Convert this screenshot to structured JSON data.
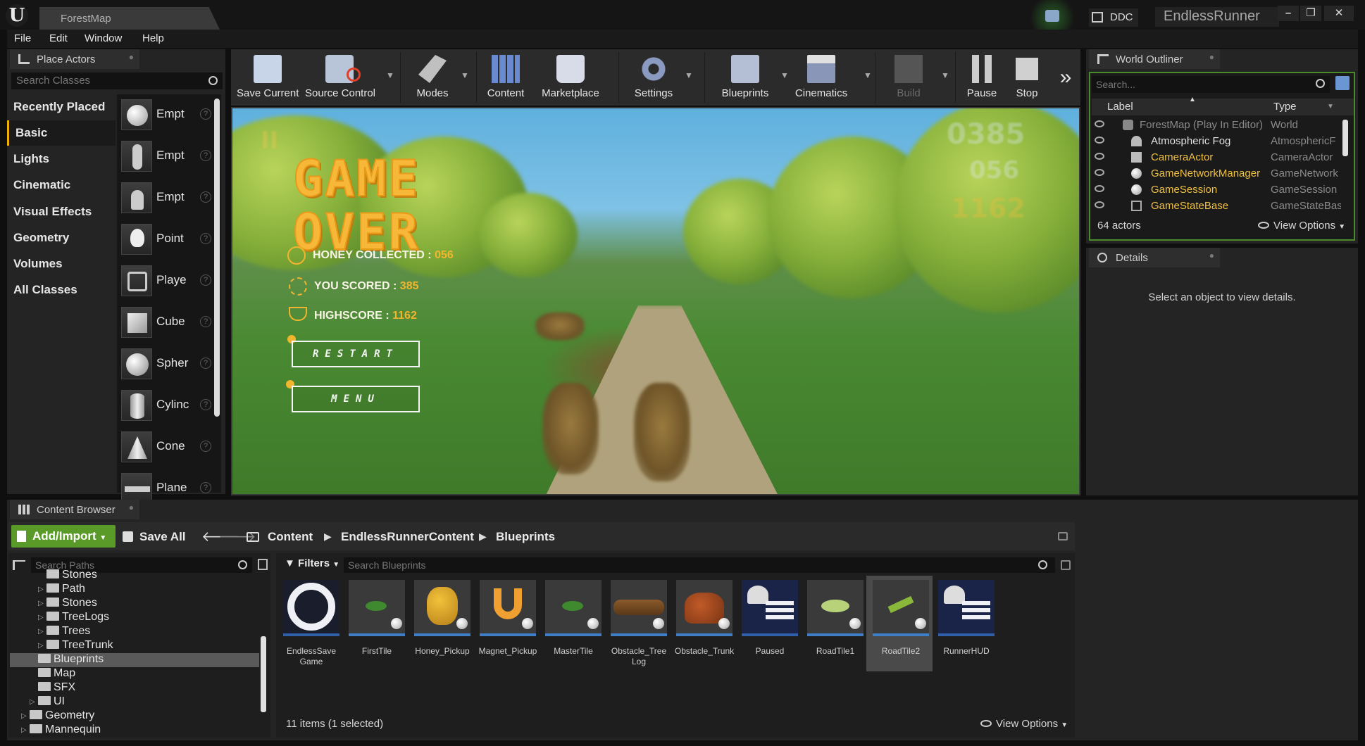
{
  "window": {
    "doc_tab": "ForestMap",
    "ddc": "DDC",
    "app_title": "EndlessRunner",
    "minimize": "–",
    "restore": "❐",
    "close": "✕"
  },
  "menu": [
    "File",
    "Edit",
    "Window",
    "Help"
  ],
  "place_actors": {
    "tab": "Place Actors",
    "search_placeholder": "Search Classes",
    "categories": [
      "Recently Placed",
      "Basic",
      "Lights",
      "Cinematic",
      "Visual Effects",
      "Geometry",
      "Volumes",
      "All Classes"
    ],
    "selected_category": "Basic",
    "items": [
      "Empt",
      "Empt",
      "Empt",
      "Point",
      "Playe",
      "Cube",
      "Spher",
      "Cylinc",
      "Cone",
      "Plane"
    ]
  },
  "toolbar": {
    "buttons": [
      "Save Current",
      "Source Control",
      "Modes",
      "Content",
      "Marketplace",
      "Settings",
      "Blueprints",
      "Cinematics",
      "Build",
      "Pause",
      "Stop"
    ],
    "more": "»"
  },
  "game": {
    "title_line1": "GAME",
    "title_line2": "OVER",
    "honey_label": "HONEY COLLECTED :",
    "honey_value": "056",
    "score_label": "YOU SCORED :",
    "score_value": "385",
    "highscore_label": "HIGHSCORE :",
    "highscore_value": "1162",
    "restart": "RESTART",
    "menu": "MENU",
    "hud_score": "0385",
    "hud_honey": "056",
    "hud_high": "1162",
    "hud_left": "II"
  },
  "outliner": {
    "tab": "World Outliner",
    "search_placeholder": "Search...",
    "col_label": "Label",
    "col_type": "Type",
    "rows": [
      {
        "label": "ForestMap (Play In Editor)",
        "type": "World"
      },
      {
        "label": "Atmospheric Fog",
        "type": "AtmosphericF"
      },
      {
        "label": "CameraActor",
        "type": "CameraActor"
      },
      {
        "label": "GameNetworkManager",
        "type": "GameNetwork"
      },
      {
        "label": "GameSession",
        "type": "GameSession"
      },
      {
        "label": "GameStateBase",
        "type": "GameStateBas"
      }
    ],
    "count": "64 actors",
    "view_options": "View Options"
  },
  "details": {
    "tab": "Details",
    "message": "Select an object to view details."
  },
  "content_browser": {
    "tab": "Content Browser",
    "add_import": "Add/Import",
    "save_all": "Save All",
    "breadcrumb": [
      "Content",
      "EndlessRunnerContent",
      "Blueprints"
    ],
    "paths_placeholder": "Search Paths",
    "filters": "Filters",
    "assets_placeholder": "Search Blueprints",
    "paths": [
      "Stones",
      "Path",
      "Stones",
      "TreeLogs",
      "Trees",
      "TreeTrunk",
      "Blueprints",
      "Map",
      "SFX",
      "UI",
      "Geometry",
      "Mannequin"
    ],
    "selected_path": "Blueprints",
    "assets": [
      "EndlessSave Game",
      "FirstTile",
      "Honey_Pickup",
      "Magnet_Pickup",
      "MasterTile",
      "Obstacle_Tree Log",
      "Obstacle_Trunk",
      "Paused",
      "RoadTile1",
      "RoadTile2",
      "RunnerHUD"
    ],
    "selected_asset": "RoadTile2",
    "count": "11 items (1 selected)",
    "view_options": "View Options"
  },
  "colors": {
    "accent_green": "#5a9a28",
    "outliner_border": "#4a8a2a",
    "game_gold": "#f2b52e",
    "selection_blue": "#3d7ec6",
    "highlight_actor": "#f0c040"
  }
}
